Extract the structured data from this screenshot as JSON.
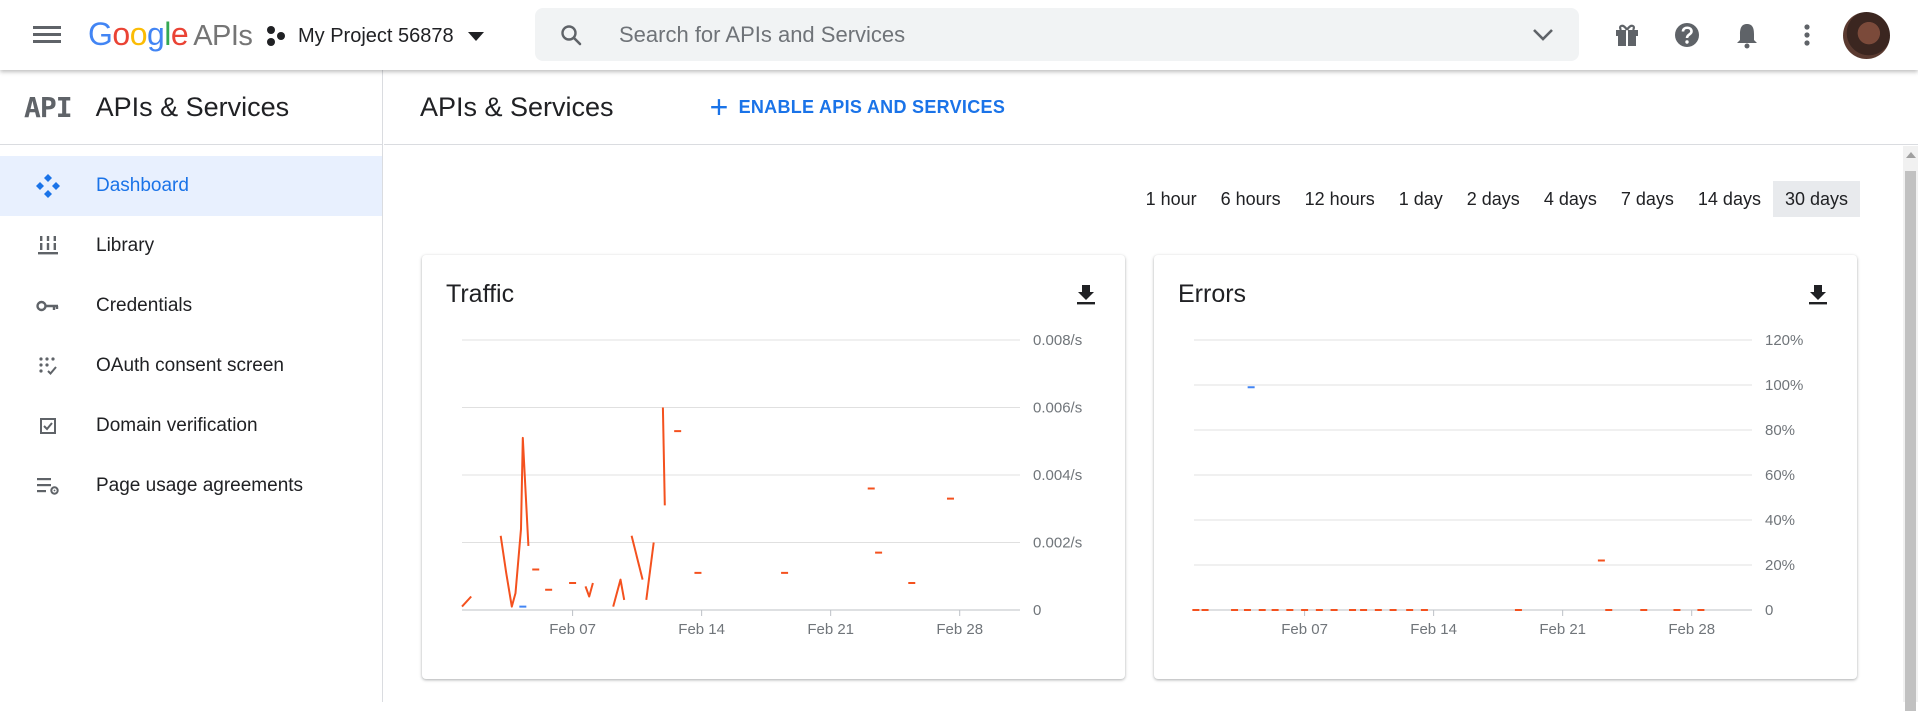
{
  "topbar": {
    "logo_google": "Google",
    "logo_apis": "APIs",
    "project_name": "My Project 56878",
    "search_placeholder": "Search for APIs and Services",
    "icons": [
      "menu-icon",
      "search-icon",
      "chevron-down-icon",
      "gift-icon",
      "help-icon",
      "notifications-icon",
      "more-vert-icon",
      "avatar"
    ]
  },
  "sidebar": {
    "mark": "API",
    "title": "APIs & Services",
    "items": [
      {
        "label": "Dashboard",
        "icon": "dashboard-icon",
        "active": true
      },
      {
        "label": "Library",
        "icon": "library-icon",
        "active": false
      },
      {
        "label": "Credentials",
        "icon": "key-icon",
        "active": false
      },
      {
        "label": "OAuth consent screen",
        "icon": "oauth-icon",
        "active": false
      },
      {
        "label": "Domain verification",
        "icon": "checkbox-icon",
        "active": false
      },
      {
        "label": "Page usage agreements",
        "icon": "settings-list-icon",
        "active": false
      }
    ]
  },
  "main": {
    "title": "APIs & Services",
    "enable_label": "ENABLE APIS AND SERVICES",
    "time_ranges": [
      "1 hour",
      "6 hours",
      "12 hours",
      "1 day",
      "2 days",
      "4 days",
      "7 days",
      "14 days",
      "30 days"
    ],
    "selected_range": "30 days"
  },
  "colors": {
    "accent": "#1a73e8",
    "series_orange": "#f4511e",
    "series_blue": "#4285f4",
    "active_bg": "#e8f0fe"
  },
  "chart_data": [
    {
      "type": "line",
      "title": "Traffic",
      "x_ticks": [
        "Feb 07",
        "Feb 14",
        "Feb 21",
        "Feb 28"
      ],
      "y_ticks": [
        "0.008/s",
        "0.006/s",
        "0.004/s",
        "0.002/s",
        "0"
      ],
      "ylim": [
        0,
        0.008
      ],
      "xlim": [
        1,
        31
      ],
      "grid": true,
      "series": [
        {
          "color": "#f4511e",
          "segments": [
            [
              [
                1.0,
                0.0001
              ],
              [
                1.5,
                0.0004
              ]
            ],
            [
              [
                3.1,
                0.0022
              ],
              [
                3.4,
                0.0011
              ],
              [
                3.7,
                0.0001
              ],
              [
                3.9,
                0.0005
              ],
              [
                4.2,
                0.0024
              ],
              [
                4.3,
                0.0051
              ],
              [
                4.6,
                0.0019
              ]
            ],
            [
              [
                5.0,
                0.0012
              ]
            ],
            [
              [
                5.7,
                0.0006
              ]
            ],
            [
              [
                7.0,
                0.0008
              ]
            ],
            [
              [
                7.7,
                0.0007
              ],
              [
                7.9,
                0.0004
              ],
              [
                8.1,
                0.0008
              ]
            ],
            [
              [
                9.2,
                0.0001
              ],
              [
                9.6,
                0.0009
              ],
              [
                9.8,
                0.0003
              ]
            ],
            [
              [
                10.2,
                0.0022
              ],
              [
                10.8,
                0.0009
              ]
            ],
            [
              [
                11.0,
                0.0003
              ],
              [
                11.4,
                0.002
              ]
            ],
            [
              [
                11.9,
                0.006
              ],
              [
                12.0,
                0.0031
              ]
            ],
            [
              [
                12.7,
                0.0053
              ]
            ],
            [
              [
                13.8,
                0.0011
              ]
            ],
            [
              [
                18.5,
                0.0011
              ]
            ],
            [
              [
                23.2,
                0.0036
              ]
            ],
            [
              [
                23.6,
                0.0017
              ]
            ],
            [
              [
                25.4,
                0.0008
              ]
            ],
            [
              [
                27.5,
                0.0033
              ]
            ]
          ]
        },
        {
          "color": "#4285f4",
          "segments": [
            [
              [
                4.3,
                0.0001
              ]
            ]
          ]
        }
      ]
    },
    {
      "type": "line",
      "title": "Errors",
      "x_ticks": [
        "Feb 07",
        "Feb 14",
        "Feb 21",
        "Feb 28"
      ],
      "y_ticks": [
        "120%",
        "100%",
        "80%",
        "60%",
        "40%",
        "20%",
        "0"
      ],
      "ylim": [
        0,
        120
      ],
      "xlim": [
        1,
        31
      ],
      "grid": true,
      "series": [
        {
          "color": "#f4511e",
          "segments": [
            [
              [
                1.1,
                0
              ]
            ],
            [
              [
                1.6,
                0
              ]
            ],
            [
              [
                3.2,
                0
              ]
            ],
            [
              [
                3.9,
                0
              ]
            ],
            [
              [
                4.7,
                0
              ]
            ],
            [
              [
                5.4,
                0
              ]
            ],
            [
              [
                6.2,
                0
              ]
            ],
            [
              [
                7.0,
                0
              ]
            ],
            [
              [
                7.8,
                0
              ]
            ],
            [
              [
                8.6,
                0
              ]
            ],
            [
              [
                9.6,
                0
              ]
            ],
            [
              [
                10.2,
                0
              ]
            ],
            [
              [
                11.0,
                0
              ]
            ],
            [
              [
                11.8,
                0
              ]
            ],
            [
              [
                12.7,
                0
              ]
            ],
            [
              [
                13.5,
                0
              ]
            ],
            [
              [
                18.6,
                0
              ]
            ],
            [
              [
                23.1,
                22
              ]
            ],
            [
              [
                23.5,
                0
              ]
            ],
            [
              [
                25.4,
                0
              ]
            ],
            [
              [
                27.2,
                0
              ]
            ],
            [
              [
                28.5,
                0
              ]
            ]
          ]
        },
        {
          "color": "#4285f4",
          "segments": [
            [
              [
                4.1,
                99
              ]
            ]
          ]
        }
      ]
    }
  ]
}
